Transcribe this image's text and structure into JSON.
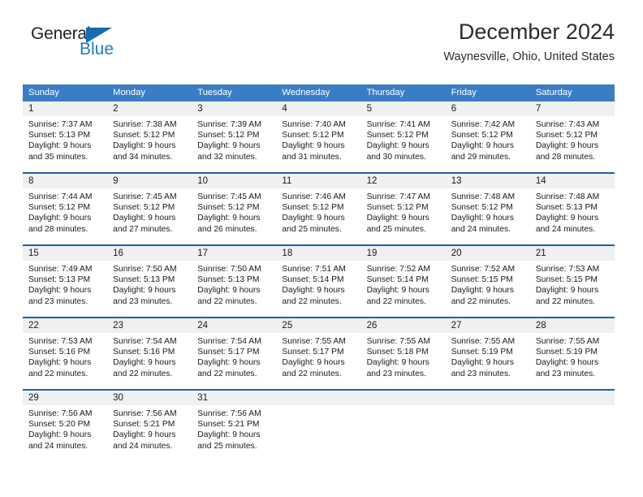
{
  "brand": {
    "name_top": "General",
    "name_bottom": "Blue",
    "triangle_icon": "blue-triangle-icon",
    "accent_color": "#1f7ac1"
  },
  "header": {
    "title": "December 2024",
    "location": "Waynesville, Ohio, United States"
  },
  "colors": {
    "header_row_bg": "#3b7dc4",
    "week_separator": "#1d62a5",
    "daynum_bg": "#f0f0f0",
    "text": "#1a1a1a"
  },
  "weekdays": [
    "Sunday",
    "Monday",
    "Tuesday",
    "Wednesday",
    "Thursday",
    "Friday",
    "Saturday"
  ],
  "labels": {
    "sunrise_prefix": "Sunrise:",
    "sunset_prefix": "Sunset:",
    "daylight_prefix": "Daylight:"
  },
  "weeks": [
    [
      {
        "day": "1",
        "line1": "Sunrise: 7:37 AM",
        "line2": "Sunset: 5:13 PM",
        "line3": "Daylight: 9 hours",
        "line4": "and 35 minutes."
      },
      {
        "day": "2",
        "line1": "Sunrise: 7:38 AM",
        "line2": "Sunset: 5:12 PM",
        "line3": "Daylight: 9 hours",
        "line4": "and 34 minutes."
      },
      {
        "day": "3",
        "line1": "Sunrise: 7:39 AM",
        "line2": "Sunset: 5:12 PM",
        "line3": "Daylight: 9 hours",
        "line4": "and 32 minutes."
      },
      {
        "day": "4",
        "line1": "Sunrise: 7:40 AM",
        "line2": "Sunset: 5:12 PM",
        "line3": "Daylight: 9 hours",
        "line4": "and 31 minutes."
      },
      {
        "day": "5",
        "line1": "Sunrise: 7:41 AM",
        "line2": "Sunset: 5:12 PM",
        "line3": "Daylight: 9 hours",
        "line4": "and 30 minutes."
      },
      {
        "day": "6",
        "line1": "Sunrise: 7:42 AM",
        "line2": "Sunset: 5:12 PM",
        "line3": "Daylight: 9 hours",
        "line4": "and 29 minutes."
      },
      {
        "day": "7",
        "line1": "Sunrise: 7:43 AM",
        "line2": "Sunset: 5:12 PM",
        "line3": "Daylight: 9 hours",
        "line4": "and 28 minutes."
      }
    ],
    [
      {
        "day": "8",
        "line1": "Sunrise: 7:44 AM",
        "line2": "Sunset: 5:12 PM",
        "line3": "Daylight: 9 hours",
        "line4": "and 28 minutes."
      },
      {
        "day": "9",
        "line1": "Sunrise: 7:45 AM",
        "line2": "Sunset: 5:12 PM",
        "line3": "Daylight: 9 hours",
        "line4": "and 27 minutes."
      },
      {
        "day": "10",
        "line1": "Sunrise: 7:45 AM",
        "line2": "Sunset: 5:12 PM",
        "line3": "Daylight: 9 hours",
        "line4": "and 26 minutes."
      },
      {
        "day": "11",
        "line1": "Sunrise: 7:46 AM",
        "line2": "Sunset: 5:12 PM",
        "line3": "Daylight: 9 hours",
        "line4": "and 25 minutes."
      },
      {
        "day": "12",
        "line1": "Sunrise: 7:47 AM",
        "line2": "Sunset: 5:12 PM",
        "line3": "Daylight: 9 hours",
        "line4": "and 25 minutes."
      },
      {
        "day": "13",
        "line1": "Sunrise: 7:48 AM",
        "line2": "Sunset: 5:12 PM",
        "line3": "Daylight: 9 hours",
        "line4": "and 24 minutes."
      },
      {
        "day": "14",
        "line1": "Sunrise: 7:48 AM",
        "line2": "Sunset: 5:13 PM",
        "line3": "Daylight: 9 hours",
        "line4": "and 24 minutes."
      }
    ],
    [
      {
        "day": "15",
        "line1": "Sunrise: 7:49 AM",
        "line2": "Sunset: 5:13 PM",
        "line3": "Daylight: 9 hours",
        "line4": "and 23 minutes."
      },
      {
        "day": "16",
        "line1": "Sunrise: 7:50 AM",
        "line2": "Sunset: 5:13 PM",
        "line3": "Daylight: 9 hours",
        "line4": "and 23 minutes."
      },
      {
        "day": "17",
        "line1": "Sunrise: 7:50 AM",
        "line2": "Sunset: 5:13 PM",
        "line3": "Daylight: 9 hours",
        "line4": "and 22 minutes."
      },
      {
        "day": "18",
        "line1": "Sunrise: 7:51 AM",
        "line2": "Sunset: 5:14 PM",
        "line3": "Daylight: 9 hours",
        "line4": "and 22 minutes."
      },
      {
        "day": "19",
        "line1": "Sunrise: 7:52 AM",
        "line2": "Sunset: 5:14 PM",
        "line3": "Daylight: 9 hours",
        "line4": "and 22 minutes."
      },
      {
        "day": "20",
        "line1": "Sunrise: 7:52 AM",
        "line2": "Sunset: 5:15 PM",
        "line3": "Daylight: 9 hours",
        "line4": "and 22 minutes."
      },
      {
        "day": "21",
        "line1": "Sunrise: 7:53 AM",
        "line2": "Sunset: 5:15 PM",
        "line3": "Daylight: 9 hours",
        "line4": "and 22 minutes."
      }
    ],
    [
      {
        "day": "22",
        "line1": "Sunrise: 7:53 AM",
        "line2": "Sunset: 5:16 PM",
        "line3": "Daylight: 9 hours",
        "line4": "and 22 minutes."
      },
      {
        "day": "23",
        "line1": "Sunrise: 7:54 AM",
        "line2": "Sunset: 5:16 PM",
        "line3": "Daylight: 9 hours",
        "line4": "and 22 minutes."
      },
      {
        "day": "24",
        "line1": "Sunrise: 7:54 AM",
        "line2": "Sunset: 5:17 PM",
        "line3": "Daylight: 9 hours",
        "line4": "and 22 minutes."
      },
      {
        "day": "25",
        "line1": "Sunrise: 7:55 AM",
        "line2": "Sunset: 5:17 PM",
        "line3": "Daylight: 9 hours",
        "line4": "and 22 minutes."
      },
      {
        "day": "26",
        "line1": "Sunrise: 7:55 AM",
        "line2": "Sunset: 5:18 PM",
        "line3": "Daylight: 9 hours",
        "line4": "and 23 minutes."
      },
      {
        "day": "27",
        "line1": "Sunrise: 7:55 AM",
        "line2": "Sunset: 5:19 PM",
        "line3": "Daylight: 9 hours",
        "line4": "and 23 minutes."
      },
      {
        "day": "28",
        "line1": "Sunrise: 7:55 AM",
        "line2": "Sunset: 5:19 PM",
        "line3": "Daylight: 9 hours",
        "line4": "and 23 minutes."
      }
    ],
    [
      {
        "day": "29",
        "line1": "Sunrise: 7:56 AM",
        "line2": "Sunset: 5:20 PM",
        "line3": "Daylight: 9 hours",
        "line4": "and 24 minutes."
      },
      {
        "day": "30",
        "line1": "Sunrise: 7:56 AM",
        "line2": "Sunset: 5:21 PM",
        "line3": "Daylight: 9 hours",
        "line4": "and 24 minutes."
      },
      {
        "day": "31",
        "line1": "Sunrise: 7:56 AM",
        "line2": "Sunset: 5:21 PM",
        "line3": "Daylight: 9 hours",
        "line4": "and 25 minutes."
      },
      {
        "day": "",
        "line1": "",
        "line2": "",
        "line3": "",
        "line4": ""
      },
      {
        "day": "",
        "line1": "",
        "line2": "",
        "line3": "",
        "line4": ""
      },
      {
        "day": "",
        "line1": "",
        "line2": "",
        "line3": "",
        "line4": ""
      },
      {
        "day": "",
        "line1": "",
        "line2": "",
        "line3": "",
        "line4": ""
      }
    ]
  ]
}
